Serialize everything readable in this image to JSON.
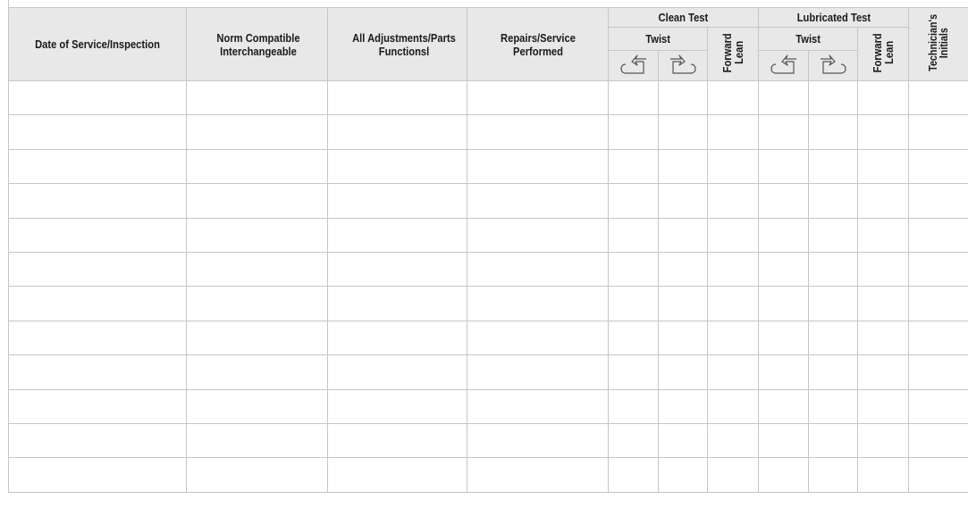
{
  "table": {
    "headers": {
      "date": "Date of Service/Inspection",
      "norm": "Norm Compatible Interchangeable",
      "adjust": "All Adjustments/Parts Functionsl",
      "repairs": "Repairs/Service Performed",
      "clean_test": "Clean Test",
      "lubricated_test": "Lubricated Test",
      "twist": "Twist",
      "forward_lean": "Forward Lean",
      "technician": "Technician's Initials"
    },
    "icons": {
      "clockwise": "clockwise-rotation-icon",
      "counterclockwise": "counterclockwise-rotation-icon"
    },
    "empty_rows": 12
  },
  "colors": {
    "header_bg": "#e8e8e8",
    "grid_line": "#c6c6c6",
    "text": "#1a1a1a"
  }
}
